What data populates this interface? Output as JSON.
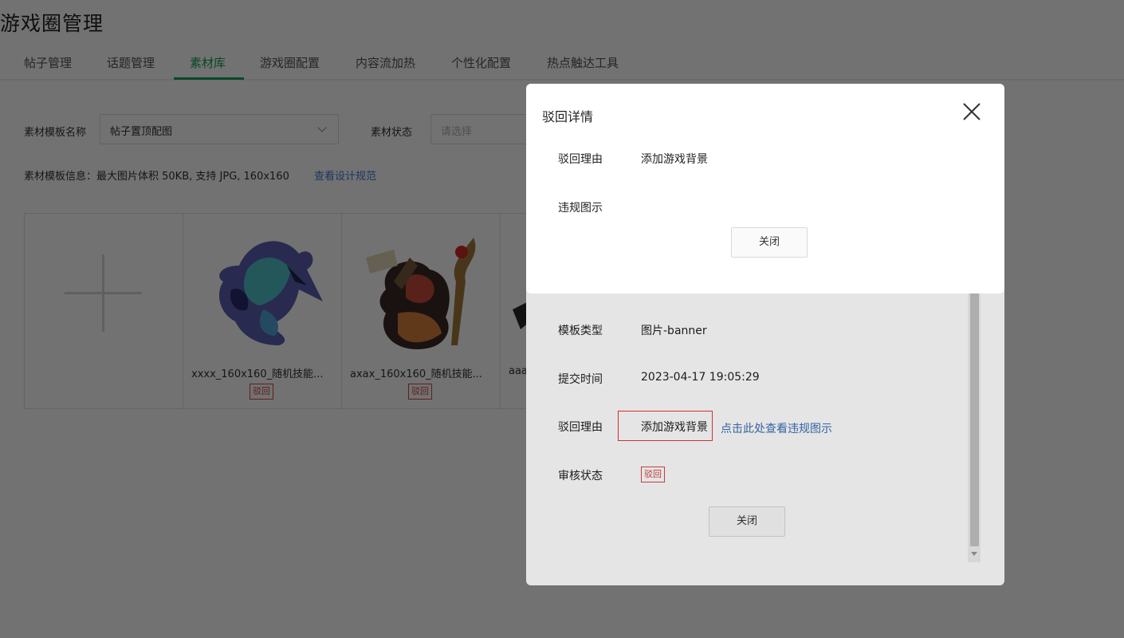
{
  "page": {
    "title": "游戏圈管理"
  },
  "tabs": [
    {
      "label": "帖子管理",
      "active": false
    },
    {
      "label": "话题管理",
      "active": false
    },
    {
      "label": "素材库",
      "active": true
    },
    {
      "label": "游戏圈配置",
      "active": false
    },
    {
      "label": "内容流加热",
      "active": false
    },
    {
      "label": "个性化配置",
      "active": false
    },
    {
      "label": "热点触达工具",
      "active": false
    }
  ],
  "filters": {
    "template_name_label": "素材模板名称",
    "template_name_value": "帖子置顶配图",
    "status_label": "素材状态",
    "status_placeholder": "请选择"
  },
  "template_info": {
    "text": "素材模板信息：最大图片体积 50KB, 支持 JPG, 160x160",
    "link": "查看设计规范"
  },
  "materials": [
    {
      "name": "xxxx_160x160_随机技能...",
      "status": "驳回",
      "icon": "blue-dragon-character-image"
    },
    {
      "name": "axax_160x160_随机技能...",
      "status": "驳回",
      "icon": "armored-warrior-character-image"
    },
    {
      "name": "aaa",
      "icon": "character-image"
    }
  ],
  "detail_modal": {
    "template_type_label": "模板类型",
    "template_type_value": "图片-banner",
    "submit_time_label": "提交时间",
    "submit_time_value": "2023-04-17 19:05:29",
    "reject_reason_label": "驳回理由",
    "reject_reason_value": "添加游戏背景",
    "view_violation_link": "点击此处查看违规图示",
    "review_status_label": "审核状态",
    "review_status_value": "驳回",
    "close_label": "关闭"
  },
  "reject_modal": {
    "title": "驳回详情",
    "reason_label": "驳回理由",
    "reason_value": "添加游戏背景",
    "violation_label": "违规图示",
    "close_label": "关闭"
  },
  "colors": {
    "accent": "#14a05a",
    "link": "#3b7bd6",
    "danger": "#d64545"
  }
}
